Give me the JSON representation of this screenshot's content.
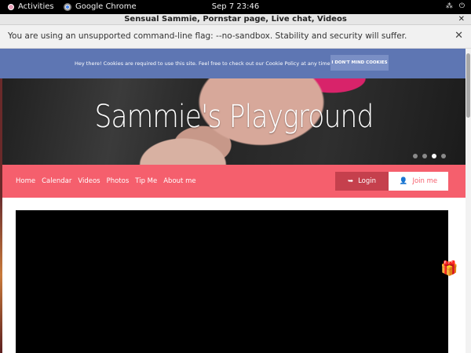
{
  "system_bar": {
    "activities": "Activities",
    "app_name": "Google Chrome",
    "clock": "Sep 7  23:46"
  },
  "window": {
    "title": "Sensual Sammie, Pornstar page, Live chat, Videos"
  },
  "infobar": {
    "message": "You are using an unsupported command-line flag: --no-sandbox. Stability and security will suffer."
  },
  "cookie_banner": {
    "text": "Hey there! Cookies are required to use this site. Feel free to check out our Cookie Policy at any time.",
    "button": "I DON'T MIND COOKIES"
  },
  "hero": {
    "title": "Sammie's Playground"
  },
  "nav": {
    "links": [
      "Home",
      "Calendar",
      "Videos",
      "Photos",
      "Tip Me",
      "About me"
    ],
    "login": "Login",
    "join": "Join me"
  },
  "colors": {
    "nav_bg": "#f55f6d",
    "cookie_bg": "#5e76b3"
  }
}
